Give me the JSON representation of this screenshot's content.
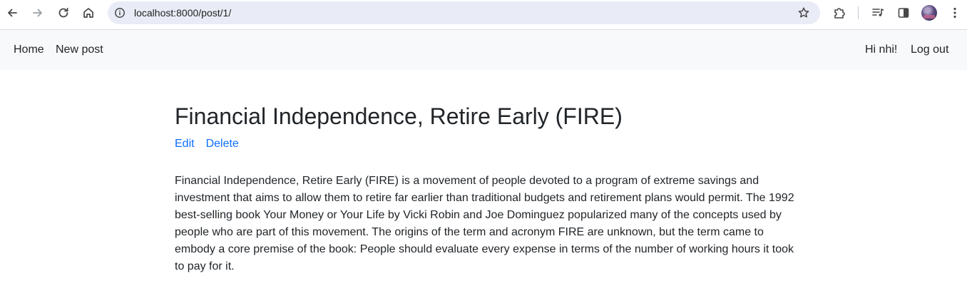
{
  "browser": {
    "url": "localhost:8000/post/1/",
    "icons": [
      "back-icon",
      "forward-icon",
      "reload-icon",
      "home-icon",
      "site-info-icon",
      "bookmark-star-icon",
      "extensions-icon",
      "media-controls-icon",
      "side-panel-icon",
      "profile-avatar",
      "menu-kebab-icon"
    ]
  },
  "navbar": {
    "home": "Home",
    "new_post": "New post",
    "greeting": "Hi nhi!",
    "logout": "Log out"
  },
  "post": {
    "title": "Financial Independence, Retire Early (FIRE)",
    "edit": "Edit",
    "delete": "Delete",
    "body": "Financial Independence, Retire Early (FIRE) is a movement of people devoted to a program of extreme savings and investment that aims to allow them to retire far earlier than traditional budgets and retirement plans would permit. The 1992 best-selling book Your Money or Your Life by Vicki Robin and Joe Dominguez popularized many of the concepts used by people who are part of this movement. The origins of the term and acronym FIRE are unknown, but the term came to embody a core premise of the book: People should evaluate every expense in terms of the number of working hours it took to pay for it."
  },
  "colors": {
    "link": "#0d6efd",
    "navbar_bg": "#f8f9fa",
    "omnibox_bg": "#e9ecf6",
    "text": "#212529"
  }
}
